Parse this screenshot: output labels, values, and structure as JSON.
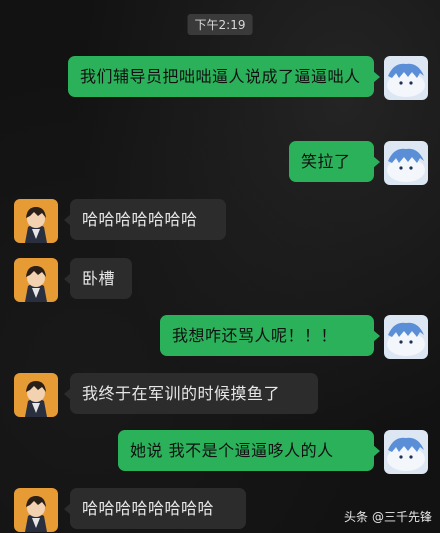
{
  "timestamp": "下午2:19",
  "messages": [
    {
      "side": "out",
      "text": "我们辅导员把咄咄逼人说成了逼逼咄人"
    },
    {
      "side": "out",
      "text": "笑拉了"
    },
    {
      "side": "in",
      "text": "哈哈哈哈哈哈哈"
    },
    {
      "side": "in",
      "text": "卧槽"
    },
    {
      "side": "out",
      "text": "我想咋还骂人呢！！！"
    },
    {
      "side": "in",
      "text": "我终于在军训的时候摸鱼了"
    },
    {
      "side": "out",
      "text": "她说 我不是个逼逼哆人的人"
    },
    {
      "side": "in",
      "text": "哈哈哈哈哈哈哈哈"
    }
  ],
  "watermark": {
    "platform": "头条",
    "author": "@三千先锋"
  }
}
